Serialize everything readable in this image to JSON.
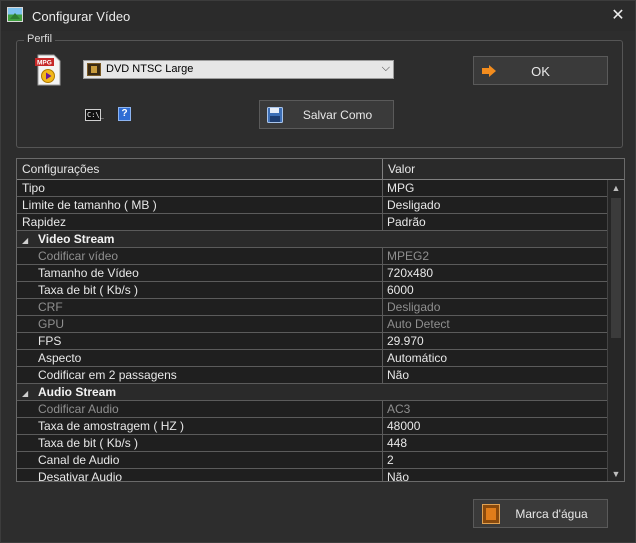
{
  "window": {
    "title": "Configurar Vídeo",
    "close_glyph": "✕"
  },
  "profile": {
    "group_label": "Perfil",
    "mpg_icon_text": "MPG",
    "selected_profile": "DVD NTSC Large",
    "combo_arrow": "⌵",
    "ok_label": "OK",
    "save_as_label": "Salvar Como",
    "cmd_icon_text": "C:\\_",
    "help_glyph": "?"
  },
  "grid": {
    "headers": {
      "settings": "Configurações",
      "value": "Valor"
    },
    "rows": [
      {
        "key": "Tipo",
        "value": "MPG"
      },
      {
        "key": "Limite de tamanho ( MB )",
        "value": "Desligado"
      },
      {
        "key": "Rapidez",
        "value": "Padrão"
      },
      {
        "section": "Video Stream"
      },
      {
        "key": "Codificar vídeo",
        "value": "MPEG2"
      },
      {
        "key": "Tamanho de Vídeo",
        "value": "720x480"
      },
      {
        "key": "Taxa de bit ( Kb/s )",
        "value": "6000"
      },
      {
        "key": "CRF",
        "value": "Desligado"
      },
      {
        "key": "GPU",
        "value": "Auto Detect"
      },
      {
        "key": "FPS",
        "value": "29.970"
      },
      {
        "key": "Aspecto",
        "value": "Automático"
      },
      {
        "key": "Codificar em 2 passagens",
        "value": "Não"
      },
      {
        "section": "Audio Stream"
      },
      {
        "key": "Codificar Audio",
        "value": "AC3"
      },
      {
        "key": "Taxa de amostragem ( HZ )",
        "value": "48000"
      },
      {
        "key": "Taxa de bit ( Kb/s )",
        "value": "448"
      },
      {
        "key": "Canal de Audio",
        "value": "2"
      },
      {
        "key": "Desativar Audio",
        "value": "Não"
      }
    ]
  },
  "watermark_label": "Marca d'água",
  "colors": {
    "background": "#2d2d2d",
    "grid_background": "#1f1f1f",
    "ok_arrow": "#f28c1e",
    "help_blue": "#2f6dd4"
  }
}
